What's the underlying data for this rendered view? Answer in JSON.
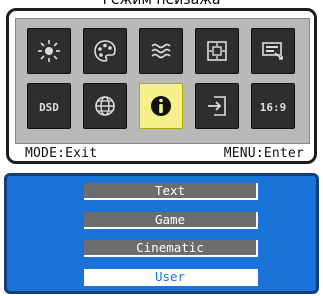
{
  "caption": "Режим пейзажа",
  "icons": [
    {
      "name": "brightness-icon"
    },
    {
      "name": "color-palette-icon"
    },
    {
      "name": "noise-reduction-icon"
    },
    {
      "name": "picture-position-icon"
    },
    {
      "name": "osd-settings-icon"
    },
    {
      "name": "dsd-icon",
      "label": "DSD"
    },
    {
      "name": "globe-language-icon"
    },
    {
      "name": "info-icon",
      "selected": true
    },
    {
      "name": "input-source-icon"
    },
    {
      "name": "aspect-ratio-icon",
      "label": "16:9"
    }
  ],
  "footer": {
    "left": "MODE:Exit",
    "right": "MENU:Enter"
  },
  "options": [
    {
      "label": "Text"
    },
    {
      "label": "Game"
    },
    {
      "label": "Cinematic"
    },
    {
      "label": "User",
      "selected": true
    }
  ],
  "colors": {
    "highlight": "#f5f08a",
    "menu_blue": "#1a73d9",
    "tile_dark": "#2e2e2e"
  }
}
